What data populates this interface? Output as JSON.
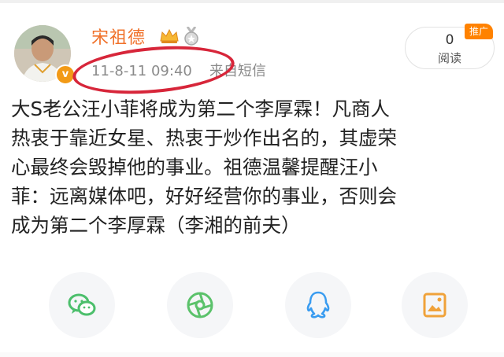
{
  "post": {
    "author": {
      "name": "宋祖德",
      "verified_badge": "v"
    },
    "time": "11-8-11 09:40",
    "source": "来自短信",
    "read": {
      "count": "0",
      "label": "阅读"
    },
    "promo_tag": "推广",
    "body_lines": [
      "大S老公汪小菲将成为第二个李厚霖！凡商人",
      "热衷于靠近女星、热衷于炒作出名的，其虚荣",
      "心最终会毁掉他的事业。祖德温馨提醒汪小",
      "菲：远离媒体吧，好好经营你的事业，否则会",
      "成为第二个李厚霖（李湘的前夫）"
    ]
  },
  "share_buttons": [
    {
      "icon": "wechat-icon",
      "color": "#4cbf6c"
    },
    {
      "icon": "moments-icon",
      "color": "#5bc26b"
    },
    {
      "icon": "qq-icon",
      "color": "#3a9cf0"
    },
    {
      "icon": "save-image-icon",
      "color": "#f0a23a"
    }
  ],
  "colors": {
    "username": "#f0712a",
    "annotation_circle": "#d7263a",
    "promo_tag": "#ff8200",
    "text": "#222222",
    "meta": "#8a8a8a"
  }
}
